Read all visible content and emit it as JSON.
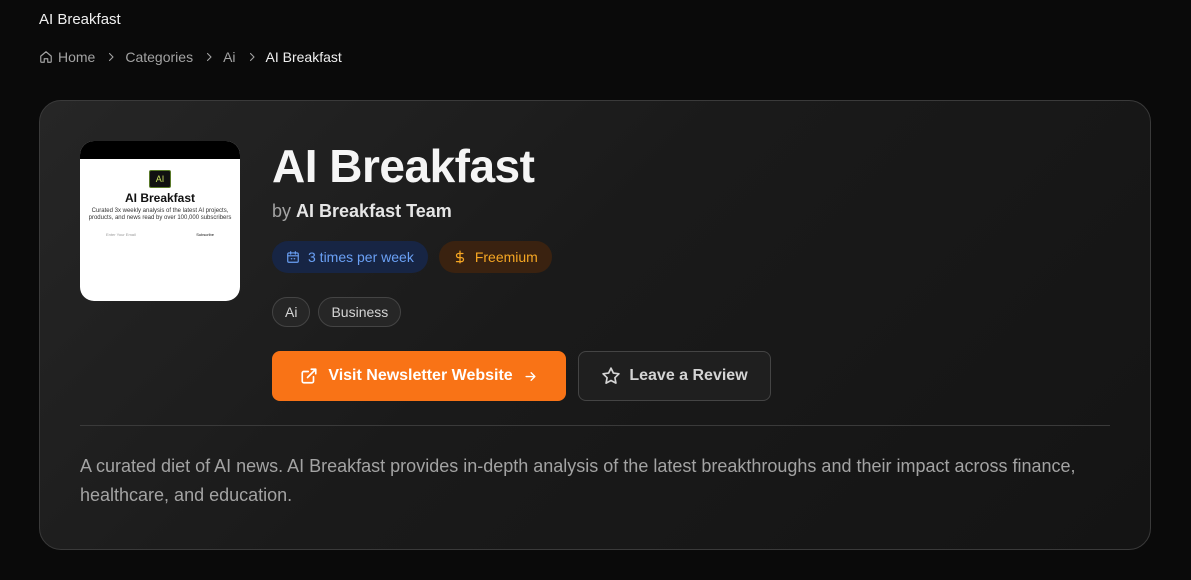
{
  "page": {
    "title": "AI Breakfast"
  },
  "breadcrumb": {
    "items": [
      "Home",
      "Categories",
      "Ai",
      "AI Breakfast"
    ]
  },
  "newsletter": {
    "name": "AI Breakfast",
    "by_prefix": "by",
    "author": "AI Breakfast Team",
    "frequency": "3 times per week",
    "pricing": "Freemium",
    "tags": [
      "Ai",
      "Business"
    ],
    "visit_label": "Visit Newsletter Website",
    "review_label": "Leave a Review",
    "description": "A curated diet of AI news. AI Breakfast provides in-depth analysis of the latest breakthroughs and their impact across finance, healthcare, and education."
  },
  "thumbnail": {
    "logo_text": "AI",
    "title": "AI Breakfast",
    "subtitle": "Curated 3x weekly analysis of the latest AI projects, products, and news read by over 100,000 subscribers",
    "email_placeholder": "Enter Your Email",
    "subscribe_label": "Subscribe"
  },
  "colors": {
    "accent": "#f97316",
    "frequency_badge": "#6aa0f5",
    "pricing_badge": "#f5a623"
  },
  "icons": {
    "home": "home-icon",
    "chevron": "chevron-right-icon",
    "calendar": "calendar-icon",
    "dollar": "dollar-icon",
    "external": "external-link-icon",
    "arrow": "arrow-right-icon",
    "star": "star-icon"
  }
}
